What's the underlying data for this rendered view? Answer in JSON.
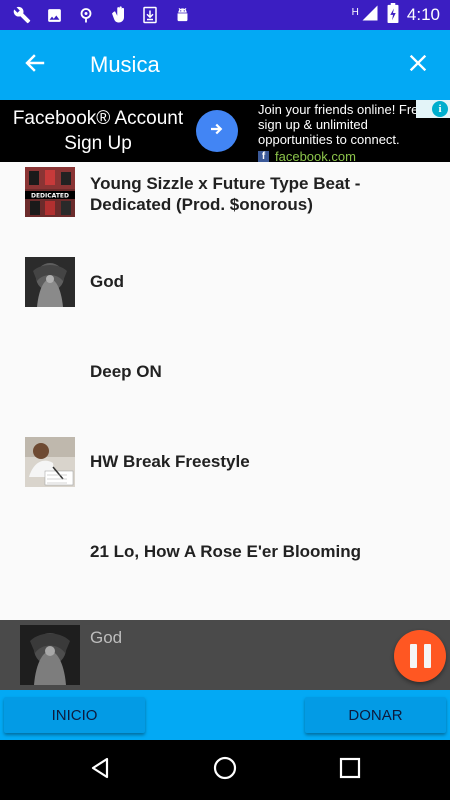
{
  "status_bar": {
    "time": "4:10",
    "network_label": "H",
    "left_icons": [
      "wrench-icon",
      "image-icon",
      "location-icon",
      "hand-icon",
      "download-icon",
      "android-icon"
    ],
    "right_icons": [
      "signal-icon",
      "battery-icon"
    ]
  },
  "toolbar": {
    "title": "Musica",
    "back_icon": "arrow-left-icon",
    "close_icon": "close-icon"
  },
  "ad": {
    "headline_line1": "Facebook® Account",
    "headline_line2": "Sign Up",
    "description": "Join your friends online! Free sign up & unlimited opportunities to connect.",
    "domain": "facebook.com",
    "brand_letter": "f",
    "info_glyph": "i",
    "colors": {
      "arrow_button": "#4285f4",
      "domain": "#8bc34a"
    }
  },
  "tracks": [
    {
      "title": "Young Sizzle x Future Type Beat - Dedicated (Prod. $onorous)",
      "thumb_text": "DEDICATED",
      "has_thumb": true
    },
    {
      "title": "God",
      "thumb_text": "",
      "has_thumb": true
    },
    {
      "title": "Deep ON",
      "thumb_text": "",
      "has_thumb": false
    },
    {
      "title": "HW Break Freestyle",
      "thumb_text": "",
      "has_thumb": true
    },
    {
      "title": "21 Lo, How A Rose E'er Blooming",
      "thumb_text": "",
      "has_thumb": false
    }
  ],
  "player": {
    "now_playing_title": "God",
    "state": "playing",
    "pause_icon": "pause-icon"
  },
  "actions": {
    "inicio_label": "INICIO",
    "donar_label": "DONAR"
  },
  "navbar": {
    "icons": [
      "back-triangle-icon",
      "home-circle-icon",
      "recents-square-icon"
    ]
  },
  "colors": {
    "status_bar": "#3b1ec2",
    "toolbar": "#03a9f4",
    "player_bg": "#4a4a4a",
    "pause_button": "#ff5722"
  }
}
